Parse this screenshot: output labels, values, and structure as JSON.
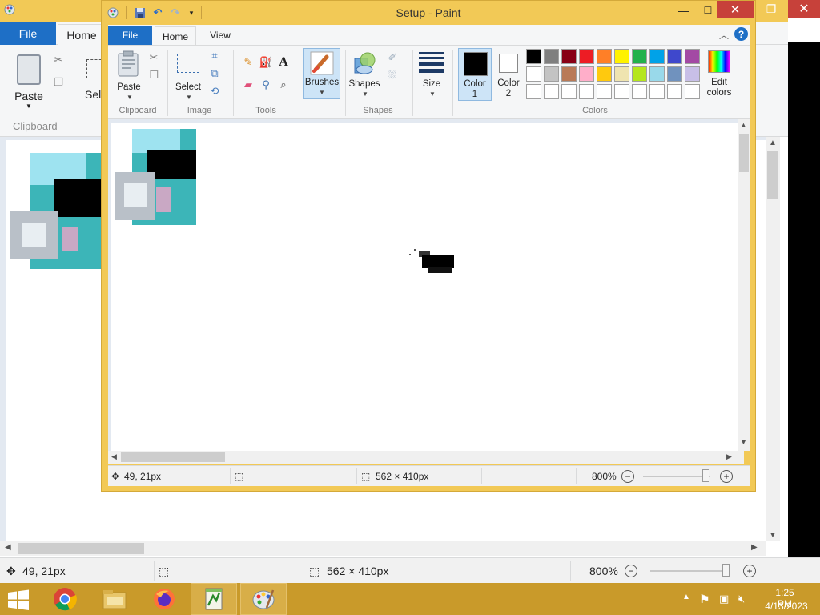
{
  "background_window": {
    "tabs": {
      "file": "File",
      "home": "Home"
    },
    "ribbon": {
      "paste": "Paste",
      "select": "Sele",
      "clipboard_group": "Clipboard"
    },
    "status": {
      "cursor_pos": "49, 21px",
      "image_size": "562 × 410px",
      "zoom": "800%"
    }
  },
  "window": {
    "title": "Setup - Paint",
    "tabs": {
      "file": "File",
      "home": "Home",
      "view": "View"
    },
    "ribbon": {
      "clipboard": {
        "paste": "Paste",
        "group": "Clipboard"
      },
      "image": {
        "select": "Select",
        "group": "Image"
      },
      "tools": {
        "group": "Tools",
        "text_glyph": "A"
      },
      "brushes": "Brushes",
      "shapes": {
        "label": "Shapes",
        "group": "Shapes"
      },
      "size": "Size",
      "color1": {
        "label": "Color",
        "num": "1",
        "value": "#000000"
      },
      "color2": {
        "label": "Color",
        "num": "2",
        "value": "#ffffff"
      },
      "colors_group": "Colors",
      "edit_colors": {
        "line1": "Edit",
        "line2": "colors"
      },
      "palette_row1": [
        "#000000",
        "#7f7f7f",
        "#880015",
        "#ed1c24",
        "#ff7f27",
        "#fff200",
        "#22b14c",
        "#00a2e8",
        "#3f48cc",
        "#a349a4"
      ],
      "palette_row2": [
        "#ffffff",
        "#c3c3c3",
        "#b97a57",
        "#ffaec9",
        "#ffc90e",
        "#efe4b0",
        "#b5e61d",
        "#99d9ea",
        "#7092be",
        "#c8bfe7"
      ],
      "palette_row3": [
        "#ffffff",
        "#ffffff",
        "#ffffff",
        "#ffffff",
        "#ffffff",
        "#ffffff",
        "#ffffff",
        "#ffffff",
        "#ffffff",
        "#ffffff"
      ]
    },
    "status": {
      "cursor_pos": "49, 21px",
      "image_size": "562 × 410px",
      "zoom": "800%"
    }
  },
  "taskbar": {
    "apps": [
      "Windows Explorer",
      "Google Chrome",
      "File Explorer",
      "Firefox",
      "Notepad++",
      "Paint"
    ],
    "clock": {
      "time": "1:25 PM",
      "date": "4/13/2023"
    }
  },
  "colors": {
    "title_bar": "#f2c956",
    "accent_blue": "#1e6fc6",
    "close_red": "#c7413a",
    "taskbar": "#c99a2a"
  }
}
